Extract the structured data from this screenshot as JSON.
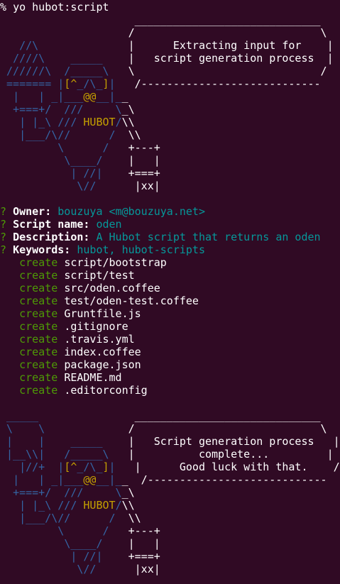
{
  "terminal": {
    "background": "#300a24",
    "colors": {
      "white": "#ffffff",
      "blue": "#3465a4",
      "yellow": "#c4a000",
      "cyan": "#06989a",
      "green": "#4e9a06",
      "gray": "#d3d7cf"
    },
    "prompt": "% ",
    "command": "yo hubot:script"
  },
  "banner1": {
    "lines": [
      [
        {
          "t": "                     _____________________________",
          "c": "w"
        }
      ],
      [
        {
          "t": "                    /                             \\",
          "c": "w"
        }
      ],
      [
        {
          "t": "   //\\              |      Extracting input for    |",
          "c": "w"
        }
      ],
      [
        {
          "t": "  ////\\    _____    |   script generation process  |",
          "c": "w"
        }
      ],
      [
        {
          "t": " //////\\  /_____\\   \\                             /",
          "c": "w"
        }
      ],
      [
        {
          "t": " ======= |[^_/\\_]|   /----------------------------",
          "c": "w"
        }
      ],
      [
        {
          "t": "  |   | _|___@@__|__",
          "c": "w"
        }
      ],
      [
        {
          "t": "  +===+/  ///     \\_\\",
          "c": "w"
        }
      ],
      [
        {
          "t": "   | |_\\ /// HUBOT/\\\\",
          "c": "w"
        }
      ],
      [
        {
          "t": "   |___/\\//      /  \\\\",
          "c": "w"
        }
      ],
      [
        {
          "t": "         \\      /   +---+",
          "c": "w"
        }
      ],
      [
        {
          "t": "          \\____/    |   |",
          "c": "w"
        }
      ],
      [
        {
          "t": "           | //|    +===+",
          "c": "w"
        }
      ],
      [
        {
          "t": "            \\//      |xx|",
          "c": "w"
        }
      ]
    ]
  },
  "answers": [
    {
      "label": "Owner:",
      "value": "bouzuya <m@bouzuya.net>"
    },
    {
      "label": "Script name:",
      "value": "oden"
    },
    {
      "label": "Description:",
      "value": "A Hubot script that returns an oden"
    },
    {
      "label": "Keywords:",
      "value": "hubot, hubot-scripts"
    }
  ],
  "files": {
    "action": "create",
    "paths": [
      "script/bootstrap",
      "script/test",
      "src/oden.coffee",
      "test/oden-test.coffee",
      "Gruntfile.js",
      ".gitignore",
      ".travis.yml",
      "index.coffee",
      "package.json",
      "README.md",
      ".editorconfig"
    ]
  },
  "banner2": {
    "lines": [
      [
        {
          "t": " _____               _____________________________",
          "c": "w"
        }
      ],
      [
        {
          "t": " \\    \\             /                             \\",
          "c": "w"
        }
      ],
      [
        {
          "t": " |    |    _____    |   Script generation process   |",
          "c": "w"
        }
      ],
      [
        {
          "t": " |__\\\\|   /_____\\   |          complete...         |",
          "c": "w"
        }
      ],
      [
        {
          "t": "   |//+  |[^_/\\_]|   |      Good luck with that.    /",
          "c": "w"
        }
      ],
      [
        {
          "t": "  |   | _|___@@__|__  /----------------------------",
          "c": "w"
        }
      ],
      [
        {
          "t": "  +===+/  ///     \\_\\",
          "c": "w"
        }
      ],
      [
        {
          "t": "   | |_\\ /// HUBOT/\\\\",
          "c": "w"
        }
      ],
      [
        {
          "t": "   |___/\\//      /  \\\\",
          "c": "w"
        }
      ],
      [
        {
          "t": "         \\      /   +---+",
          "c": "w"
        }
      ],
      [
        {
          "t": "          \\____/    |   |",
          "c": "w"
        }
      ],
      [
        {
          "t": "           | //|    +===+",
          "c": "w"
        }
      ],
      [
        {
          "t": "            \\//      |xx|",
          "c": "w"
        }
      ]
    ]
  }
}
